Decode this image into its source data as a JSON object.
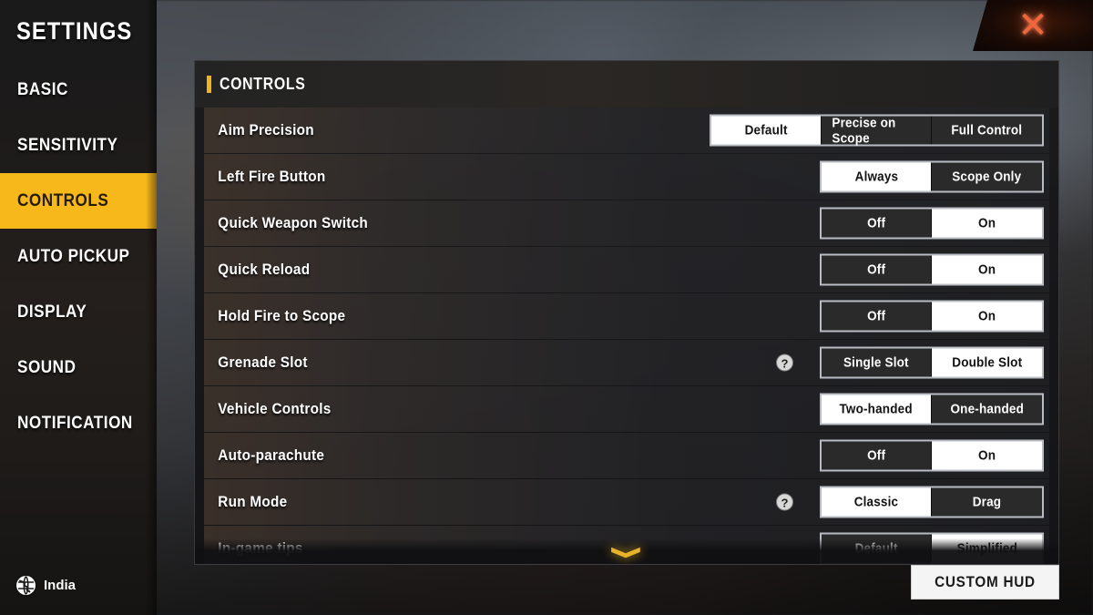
{
  "window": {
    "close_icon": "close-icon"
  },
  "sidebar": {
    "title": "SETTINGS",
    "items": [
      {
        "label": "BASIC",
        "active": false
      },
      {
        "label": "SENSITIVITY",
        "active": false
      },
      {
        "label": "CONTROLS",
        "active": true
      },
      {
        "label": "AUTO PICKUP",
        "active": false
      },
      {
        "label": "DISPLAY",
        "active": false
      },
      {
        "label": "SOUND",
        "active": false
      },
      {
        "label": "NOTIFICATION",
        "active": false
      }
    ],
    "region": {
      "icon": "globe-icon",
      "label": "India"
    }
  },
  "panel": {
    "header": "CONTROLS",
    "scroll_hint_icon": "chevron-down-icon",
    "settings": [
      {
        "name": "Aim Precision",
        "help": false,
        "options": [
          "Default",
          "Precise on Scope",
          "Full Control"
        ],
        "selected": "Default"
      },
      {
        "name": "Left Fire Button",
        "help": false,
        "options": [
          "Always",
          "Scope Only"
        ],
        "selected": "Always"
      },
      {
        "name": "Quick Weapon Switch",
        "help": false,
        "options": [
          "Off",
          "On"
        ],
        "selected": "On"
      },
      {
        "name": "Quick Reload",
        "help": false,
        "options": [
          "Off",
          "On"
        ],
        "selected": "On"
      },
      {
        "name": "Hold Fire to Scope",
        "help": false,
        "options": [
          "Off",
          "On"
        ],
        "selected": "On"
      },
      {
        "name": "Grenade Slot",
        "help": true,
        "options": [
          "Single Slot",
          "Double Slot"
        ],
        "selected": "Double Slot"
      },
      {
        "name": "Vehicle Controls",
        "help": false,
        "options": [
          "Two-handed",
          "One-handed"
        ],
        "selected": "Two-handed"
      },
      {
        "name": "Auto-parachute",
        "help": false,
        "options": [
          "Off",
          "On"
        ],
        "selected": "On"
      },
      {
        "name": "Run Mode",
        "help": true,
        "options": [
          "Classic",
          "Drag"
        ],
        "selected": "Classic"
      },
      {
        "name": "In-game tips",
        "help": false,
        "options": [
          "Default",
          "Simplified"
        ],
        "selected": "Simplified"
      }
    ]
  },
  "footer": {
    "custom_hud_label": "CUSTOM HUD"
  },
  "colors": {
    "accent": "#f7b81c",
    "close": "#f0663a",
    "selected_segment_bg": "#ffffff"
  }
}
